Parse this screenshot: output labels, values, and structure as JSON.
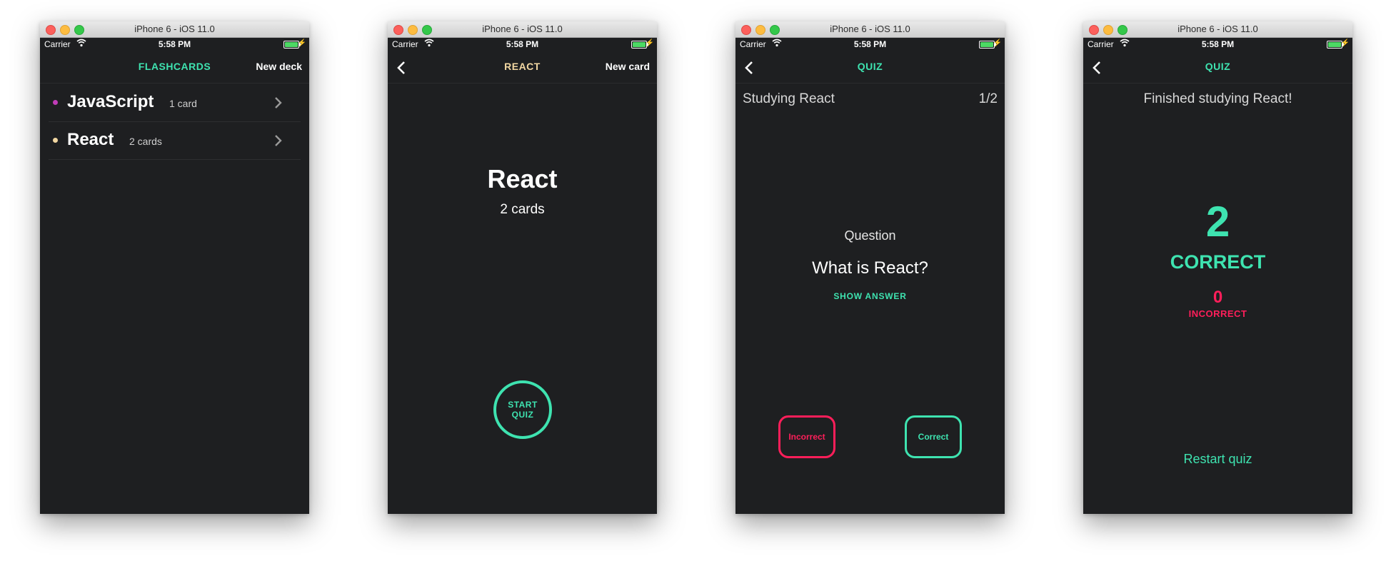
{
  "simulator_title": "iPhone 6 - iOS 11.0",
  "status": {
    "carrier": "Carrier",
    "time": "5:58 PM"
  },
  "colors": {
    "accent": "#3ee3b0",
    "react": "#f2d7a2",
    "error": "#ff1e5a",
    "bg": "#1e1f21",
    "javascript": "#c13cb8"
  },
  "screen1": {
    "title": "FLASHCARDS",
    "right_action": "New deck",
    "decks": [
      {
        "name": "JavaScript",
        "count": "1 card",
        "dot_color": "#c13cb8"
      },
      {
        "name": "React",
        "count": "2 cards",
        "dot_color": "#f2d7a2"
      }
    ]
  },
  "screen2": {
    "title": "REACT",
    "right_action": "New card",
    "deck_name": "React",
    "deck_count": "2 cards",
    "start_line1": "START",
    "start_line2": "QUIZ"
  },
  "screen3": {
    "title": "QUIZ",
    "studying": "Studying React",
    "progress": "1/2",
    "label": "Question",
    "question": "What is React?",
    "show_answer": "SHOW ANSWER",
    "incorrect_btn": "Incorrect",
    "correct_btn": "Correct"
  },
  "screen4": {
    "title": "QUIZ",
    "finished": "Finished studying React!",
    "correct_count": "2",
    "correct_label": "CORRECT",
    "incorrect_count": "0",
    "incorrect_label": "INCORRECT",
    "restart": "Restart quiz"
  }
}
